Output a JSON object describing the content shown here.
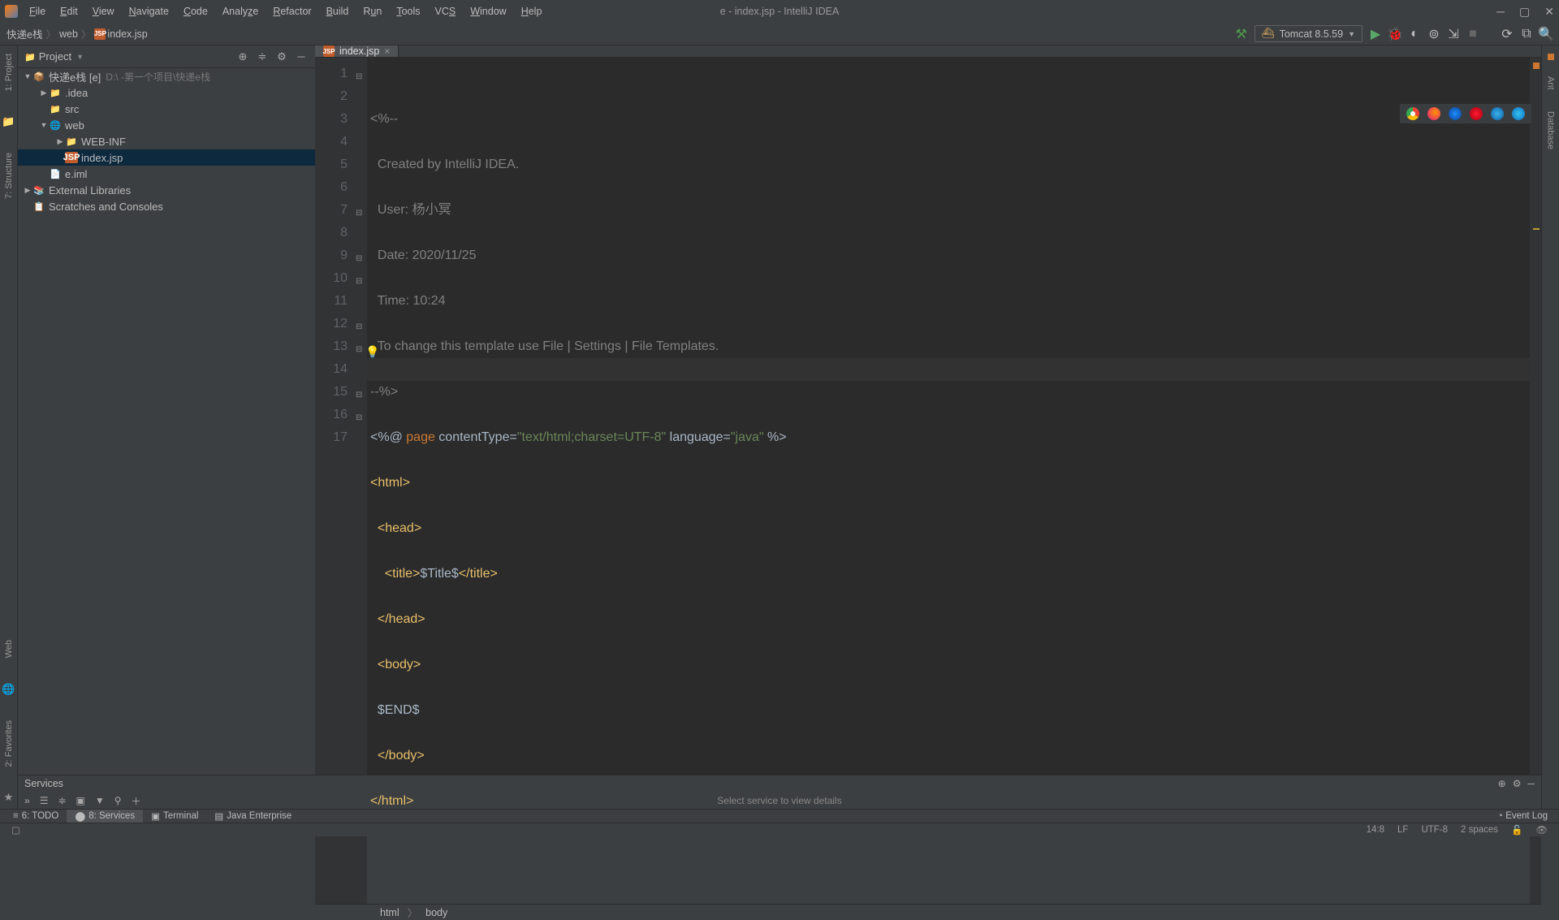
{
  "title": "e - index.jsp - IntelliJ IDEA",
  "menu": [
    "File",
    "Edit",
    "View",
    "Navigate",
    "Code",
    "Analyze",
    "Refactor",
    "Build",
    "Run",
    "Tools",
    "VCS",
    "Window",
    "Help"
  ],
  "breadcrumbs": [
    "快递e栈",
    "web",
    "index.jsp"
  ],
  "runConfig": "Tomcat 8.5.59",
  "project": {
    "title": "Project",
    "root": {
      "name": "快递e栈 [e]",
      "path": "D:\\...\\-第一个项目\\快递e栈"
    },
    "nodes": [
      {
        "level": 1,
        "arrow": "▼",
        "icon": "📦",
        "label": "快递e栈 [e]",
        "dim": "D:\\               -第一个项目\\快递e栈"
      },
      {
        "level": 2,
        "arrow": "▶",
        "icon": "📁",
        "label": ".idea"
      },
      {
        "level": 2,
        "arrow": "",
        "icon": "📁",
        "label": "src"
      },
      {
        "level": 2,
        "arrow": "▼",
        "icon": "🌐",
        "label": "web"
      },
      {
        "level": 3,
        "arrow": "▶",
        "icon": "📁",
        "label": "WEB-INF"
      },
      {
        "level": 3,
        "arrow": "",
        "icon": "jsp",
        "label": "index.jsp",
        "sel": true
      },
      {
        "level": 2,
        "arrow": "",
        "icon": "📄",
        "label": "e.iml"
      },
      {
        "level": 1,
        "arrow": "▶",
        "icon": "📚",
        "label": "External Libraries"
      },
      {
        "level": 1,
        "arrow": "",
        "icon": "📋",
        "label": "Scratches and Consoles"
      }
    ]
  },
  "editor": {
    "tab": "index.jsp",
    "lines": 17,
    "code": {
      "l1": "<%--",
      "l2": "  Created by IntelliJ IDEA.",
      "l3": "  User: 杨小冥",
      "l4": "  Date: 2020/11/25",
      "l5": "  Time: 10:24",
      "l6": "  To change this template use File | Settings | File Templates.",
      "l7": "--%>",
      "l8a": "<%@ ",
      "l8b": "page",
      "l8c": " contentType=",
      "l8d": "\"text/html;charset=UTF-8\"",
      "l8e": " language=",
      "l8f": "\"java\"",
      "l8g": " %>",
      "l9": "<html>",
      "l10": "  <head>",
      "l11a": "    <title>",
      "l11b": "$Title$",
      "l11c": "</title>",
      "l12": "  </head>",
      "l13": "  <body>",
      "l14": "  $END$",
      "l15": "  </body>",
      "l16": "</html>"
    },
    "crumb": [
      "html",
      "body"
    ]
  },
  "leftTabs": [
    "1: Project",
    "7: Structure",
    "2: Favorites",
    "Web"
  ],
  "rightTabs": [
    "Ant",
    "Database"
  ],
  "services": {
    "title": "Services",
    "hint": "Select service to view details"
  },
  "bottomTabs": [
    "6: TODO",
    "8: Services",
    "Terminal",
    "Java Enterprise"
  ],
  "eventLog": "Event Log",
  "status": {
    "pos": "14:8",
    "sep": "LF",
    "enc": "UTF-8",
    "indent": "2 spaces"
  }
}
